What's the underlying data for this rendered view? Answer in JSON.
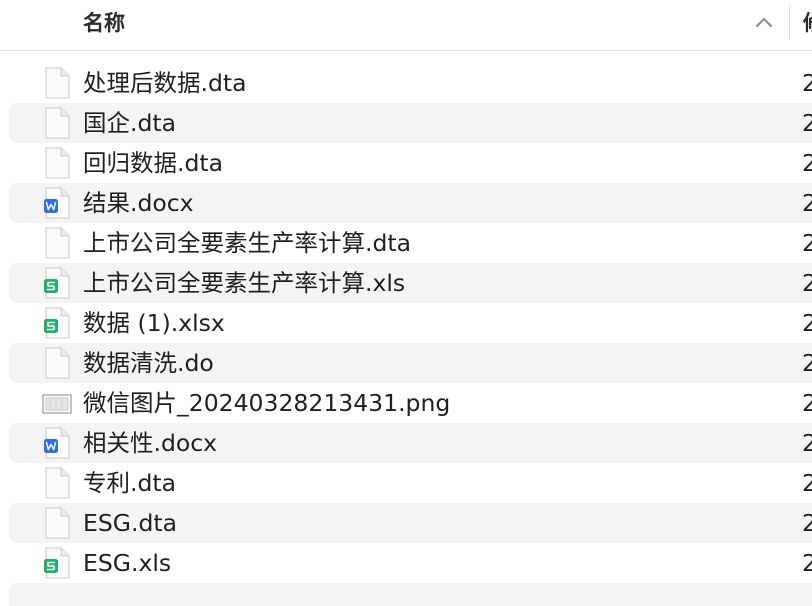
{
  "header": {
    "name_label": "名称",
    "next_column_label": "修"
  },
  "files": [
    {
      "name": "处理后数据.dta",
      "icon": "generic-file-icon",
      "date": "2"
    },
    {
      "name": "国企.dta",
      "icon": "generic-file-icon",
      "date": "2"
    },
    {
      "name": "回归数据.dta",
      "icon": "generic-file-icon",
      "date": "2"
    },
    {
      "name": "结果.docx",
      "icon": "word-document-icon",
      "date": "2"
    },
    {
      "name": "上市公司全要素生产率计算.dta",
      "icon": "generic-file-icon",
      "date": "2"
    },
    {
      "name": "上市公司全要素生产率计算.xls",
      "icon": "spreadsheet-icon",
      "date": "2"
    },
    {
      "name": "数据 (1).xlsx",
      "icon": "spreadsheet-icon",
      "date": "2"
    },
    {
      "name": "数据清洗.do",
      "icon": "generic-file-icon",
      "date": "2"
    },
    {
      "name": "微信图片_20240328213431.png",
      "icon": "image-file-icon",
      "date": "2"
    },
    {
      "name": "相关性.docx",
      "icon": "word-document-icon",
      "date": "2"
    },
    {
      "name": "专利.dta",
      "icon": "generic-file-icon",
      "date": "2"
    },
    {
      "name": "ESG.dta",
      "icon": "generic-file-icon",
      "date": "2"
    },
    {
      "name": "ESG.xls",
      "icon": "spreadsheet-icon",
      "date": "2"
    }
  ],
  "colors": {
    "word_blue": "#2f6fe4",
    "sheet_green": "#1fb16a",
    "row_stripe": "#f4f4f5"
  }
}
